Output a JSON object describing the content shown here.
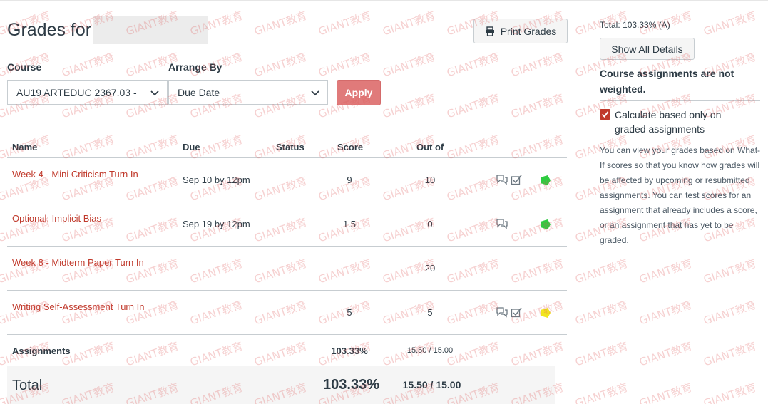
{
  "page": {
    "title": "Grades for",
    "print_label": "Print Grades"
  },
  "filters": {
    "course_label": "Course",
    "course_value": "AU19 ARTEDUC 2367.03 -",
    "arrange_label": "Arrange By",
    "arrange_value": "Due Date",
    "apply_label": "Apply"
  },
  "table": {
    "headers": {
      "name": "Name",
      "due": "Due",
      "status": "Status",
      "score": "Score",
      "out_of": "Out of"
    },
    "rows": [
      {
        "name": "Week 4 - Mini Criticism Turn In",
        "due": "Sep 10 by 12pm",
        "score": "9",
        "out_of": "10",
        "icons": [
          "comment-icon",
          "rubric-icon"
        ],
        "flag_color": "#2ecc40"
      },
      {
        "name": "Optional: Implicit Bias",
        "due": "Sep 19 by 12pm",
        "score": "1.5",
        "out_of": "0",
        "icons": [
          "comment-icon"
        ],
        "flag_color": "#2ecc40"
      },
      {
        "name": "Week 8 - Midterm Paper Turn In",
        "due": "",
        "score": "-",
        "out_of": "20",
        "icons": [],
        "flag_color": ""
      },
      {
        "name": "Writing Self-Assessment Turn In",
        "due": "",
        "score": "5",
        "out_of": "5",
        "icons": [
          "comment-icon",
          "rubric-icon"
        ],
        "flag_color": "#f1e51f"
      }
    ],
    "assignments_summary": {
      "name": "Assignments",
      "percent": "103.33%",
      "fraction": "15.50 / 15.00"
    },
    "total": {
      "name": "Total",
      "percent": "103.33%",
      "fraction": "15.50 / 15.00"
    }
  },
  "sidebar": {
    "total_text": "Total: 103.33% (A)",
    "show_details_label": "Show All Details",
    "weight_note": "Course assignments are not weighted.",
    "calc_checkbox_label": "Calculate based only on graded assignments",
    "calc_checked": true,
    "whatif_text": "You can view your grades based on What-If scores so that you know how grades will be affected by upcoming or resubmitted assignments. You can test scores for an assignment that already includes a score, or an assignment that has yet to be graded."
  },
  "watermark": {
    "text": "GIANT教育"
  },
  "colors": {
    "link": "#c0392b",
    "apply": "#e07a7a",
    "checkbox": "#c0392b"
  }
}
